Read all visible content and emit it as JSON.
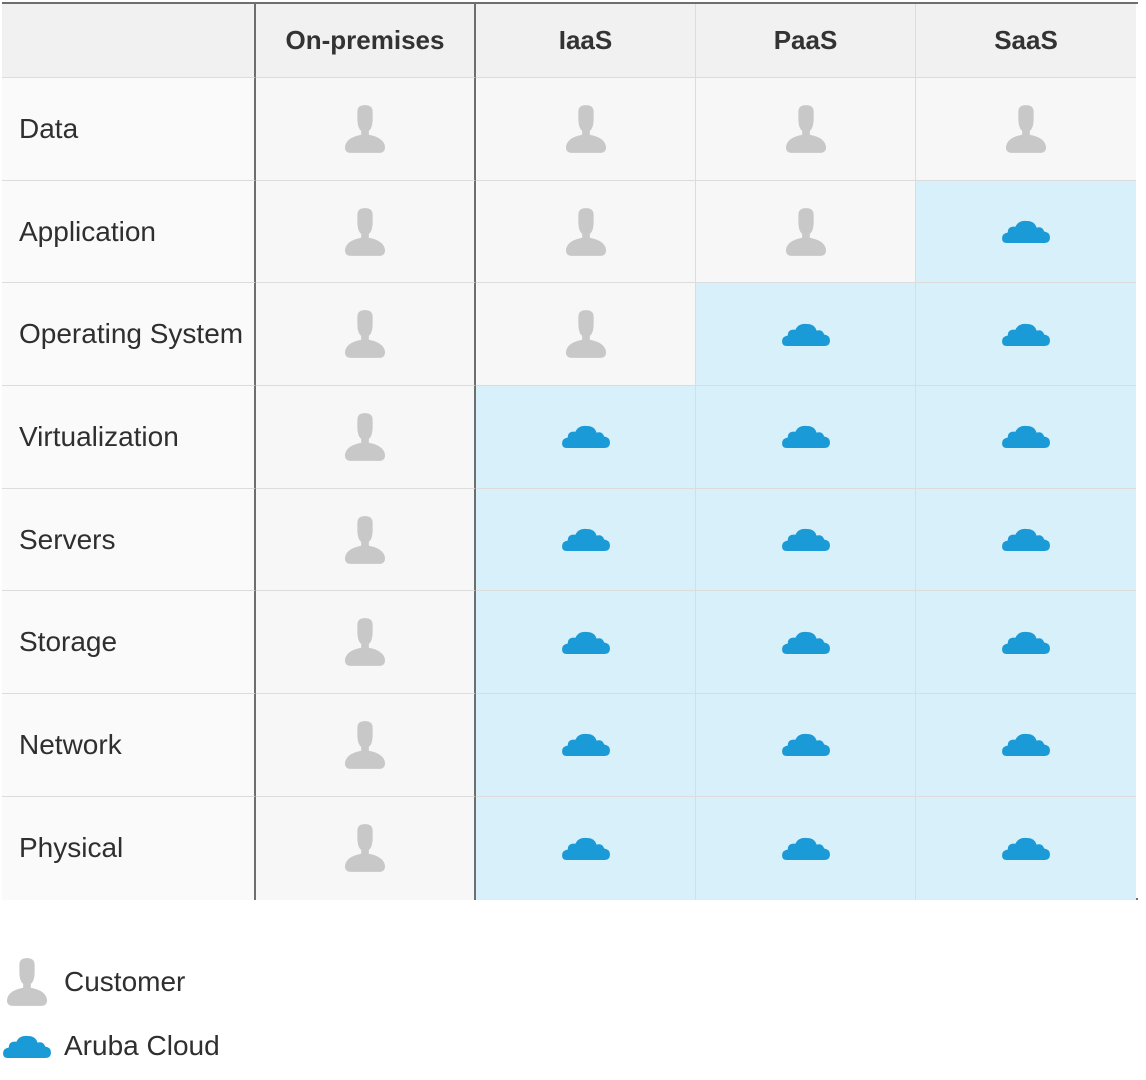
{
  "columns": [
    "On-premises",
    "IaaS",
    "PaaS",
    "SaaS"
  ],
  "rows": [
    {
      "label": "Data",
      "cells": [
        "customer",
        "customer",
        "customer",
        "customer"
      ]
    },
    {
      "label": "Application",
      "cells": [
        "customer",
        "customer",
        "customer",
        "cloud"
      ]
    },
    {
      "label": "Operating System",
      "cells": [
        "customer",
        "customer",
        "cloud",
        "cloud"
      ]
    },
    {
      "label": "Virtualization",
      "cells": [
        "customer",
        "cloud",
        "cloud",
        "cloud"
      ]
    },
    {
      "label": "Servers",
      "cells": [
        "customer",
        "cloud",
        "cloud",
        "cloud"
      ]
    },
    {
      "label": "Storage",
      "cells": [
        "customer",
        "cloud",
        "cloud",
        "cloud"
      ]
    },
    {
      "label": "Network",
      "cells": [
        "customer",
        "cloud",
        "cloud",
        "cloud"
      ]
    },
    {
      "label": "Physical",
      "cells": [
        "customer",
        "cloud",
        "cloud",
        "cloud"
      ]
    }
  ],
  "legend": [
    {
      "key": "customer",
      "label": "Customer",
      "icon": "person-icon"
    },
    {
      "key": "cloud",
      "label": "Aruba Cloud",
      "icon": "cloud-icon"
    }
  ],
  "colors": {
    "customer_icon": "#c8c8c8",
    "cloud_icon": "#1a9ad6",
    "cloud_cell": "#d7f0fa",
    "customer_cell": "#f7f7f7",
    "header_cell": "#f1f1f1"
  }
}
